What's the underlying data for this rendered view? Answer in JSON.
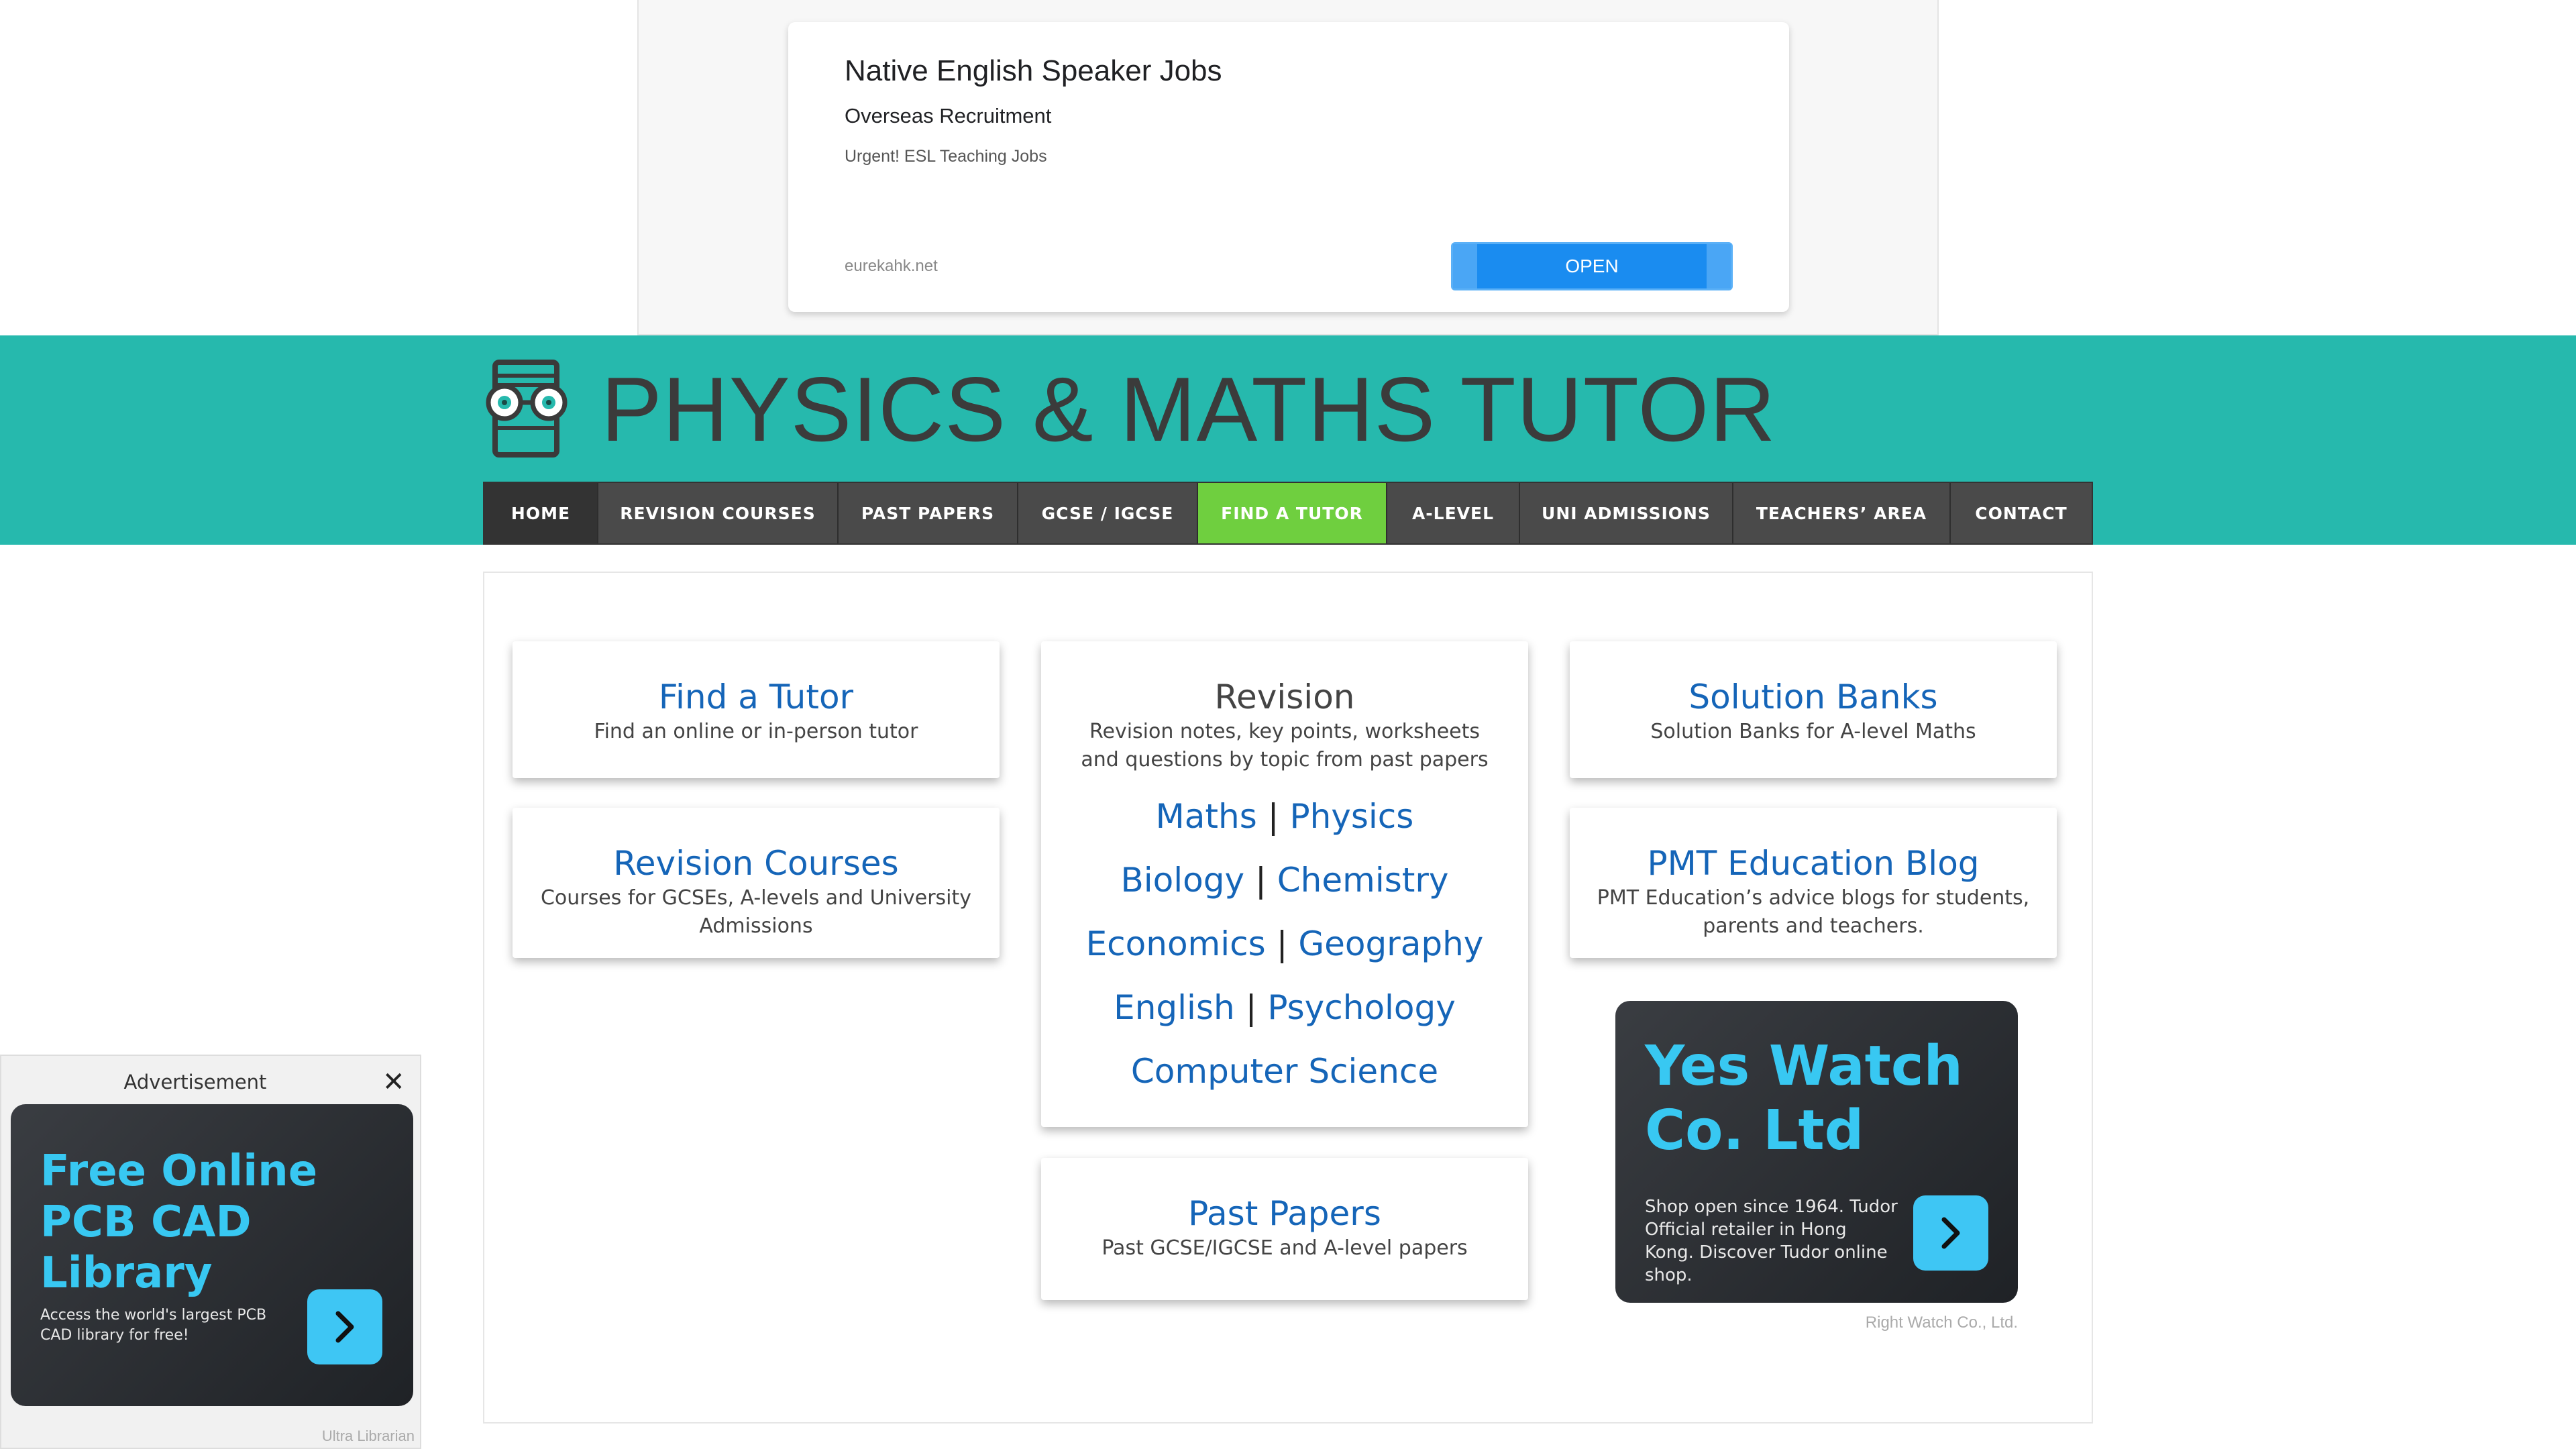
{
  "top_ad": {
    "headline": "Native English Speaker Jobs",
    "subheadline": "Overseas Recruitment",
    "body": "Urgent! ESL Teaching Jobs",
    "domain": "eurekahk.net",
    "cta": "OPEN"
  },
  "header": {
    "site_title": "PHYSICS & MATHS TUTOR",
    "brand_color": "#26b9ad"
  },
  "nav": {
    "items": [
      {
        "label": "HOME"
      },
      {
        "label": "REVISION COURSES"
      },
      {
        "label": "PAST PAPERS"
      },
      {
        "label": "GCSE / IGCSE"
      },
      {
        "label": "FIND A TUTOR"
      },
      {
        "label": "A-LEVEL"
      },
      {
        "label": "UNI ADMISSIONS"
      },
      {
        "label": "TEACHERS’ AREA"
      },
      {
        "label": "CONTACT"
      }
    ],
    "active": "FIND A TUTOR",
    "active_color": "#6fcf3f"
  },
  "cards": {
    "find_tutor": {
      "title": "Find a Tutor",
      "desc": "Find an online or in-person tutor"
    },
    "revision_courses": {
      "title": "Revision Courses",
      "desc": "Courses for GCSEs, A-levels and University Admissions"
    },
    "revision": {
      "title": "Revision",
      "desc": "Revision notes, key points, worksheets and questions by topic from past papers",
      "subjects": [
        "Maths",
        "Physics",
        "Biology",
        "Chemistry",
        "Economics",
        "Geography",
        "English",
        "Psychology",
        "Computer Science"
      ],
      "separator": "|"
    },
    "past_papers": {
      "title": "Past Papers",
      "desc": "Past GCSE/IGCSE and A-level papers"
    },
    "solution_banks": {
      "title": "Solution Banks",
      "desc": "Solution Banks for A-level Maths"
    },
    "blog": {
      "title": "PMT Education Blog",
      "desc": "PMT Education’s advice blogs for students, parents and teachers."
    }
  },
  "side_ad": {
    "headline": "Yes Watch Co. Ltd",
    "body": "Shop open since 1964. Tudor Official retailer in Hong Kong. Discover Tudor online shop.",
    "footer": "Right Watch Co., Ltd."
  },
  "bottom_ad": {
    "label": "Advertisement",
    "close": "✕",
    "headline": "Free Online PCB CAD Library",
    "body": "Access the world's largest PCB CAD library for free!",
    "footer": "Ultra Librarian"
  },
  "icons": {
    "logo": "book-with-glasses-icon",
    "arrow": "chevron-right-icon",
    "close": "close-icon"
  }
}
